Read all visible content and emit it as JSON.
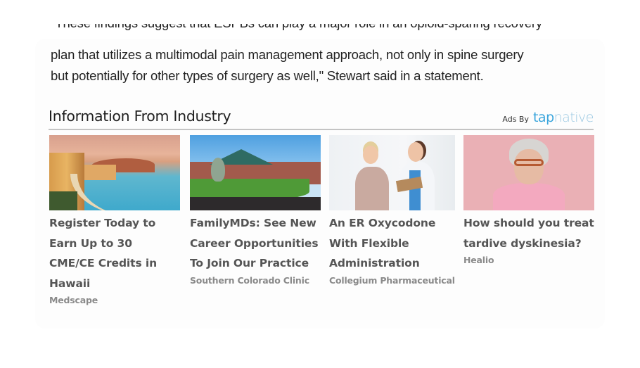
{
  "article": {
    "line1_partial": "\"These findings suggest that ESPBs can play a major role in an opioid-sparing recovery",
    "line2": "plan that utilizes a multimodal pain management approach, not only in spine surgery",
    "line3": "but potentially for other types of surgery as well,\" Stewart said in a statement."
  },
  "industry": {
    "title": "Information From Industry",
    "ads_by_label": "Ads By",
    "logo_part1": "tap",
    "logo_part2": "native",
    "cards": [
      {
        "title": "Register Today to Earn Up to 30 CME/CE Credits in Hawaii",
        "source": "Medscape",
        "image": "hawaii-beach-photo"
      },
      {
        "title": "FamilyMDs: See New Career Opportunities To Join Our Practice",
        "source": "Southern Colorado Clinic",
        "image": "clinic-building-photo"
      },
      {
        "title": "An ER Oxycodone With Flexible Administration",
        "source": "Collegium Pharmaceutical",
        "image": "doctor-patient-photo"
      },
      {
        "title": "How should you treat tardive dyskinesia?",
        "source": "Healio",
        "image": "elderly-woman-photo"
      }
    ]
  }
}
